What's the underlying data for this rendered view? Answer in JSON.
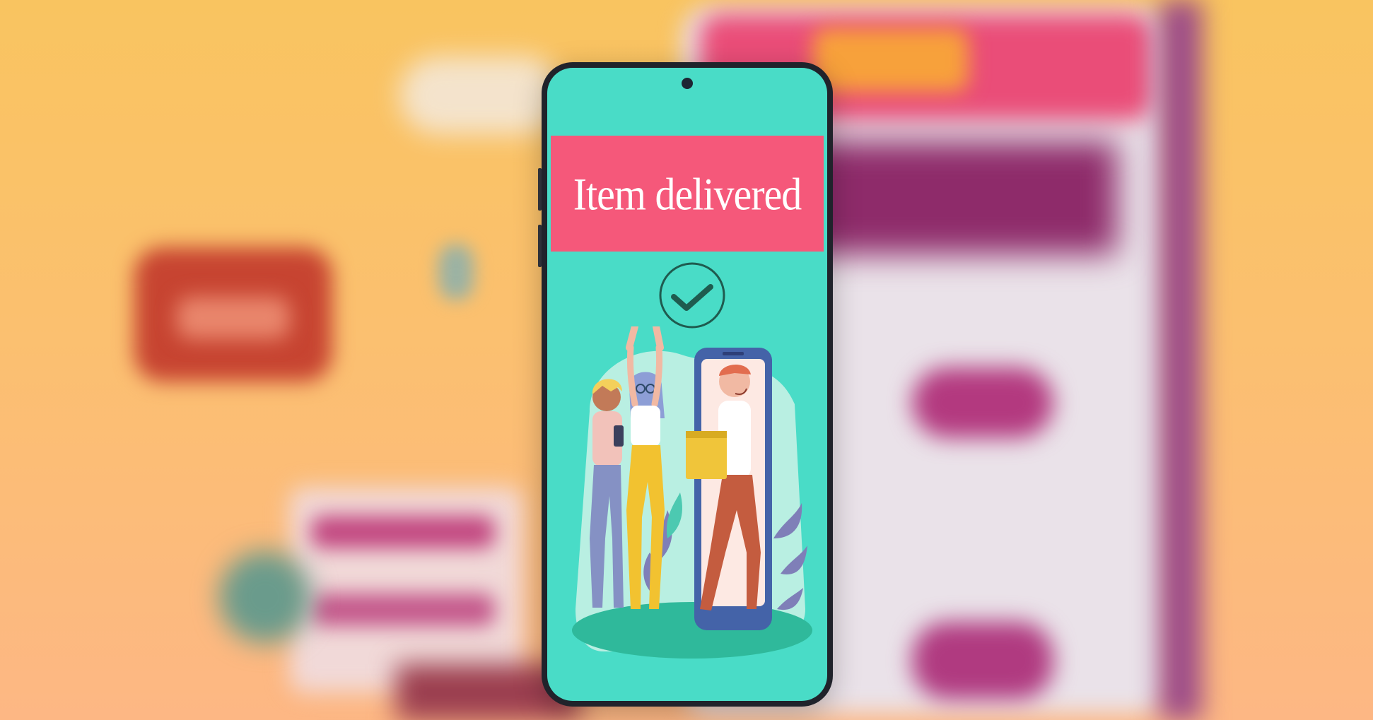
{
  "background": {
    "description_free": true
  },
  "phone": {
    "banner": {
      "title": "Item delivered"
    },
    "icons": {
      "status": "check-circle-icon",
      "camera": "camera-icon"
    },
    "colors": {
      "screen": "#49dcc7",
      "banner": "#f5587a",
      "check": "#1f5b4f"
    }
  }
}
